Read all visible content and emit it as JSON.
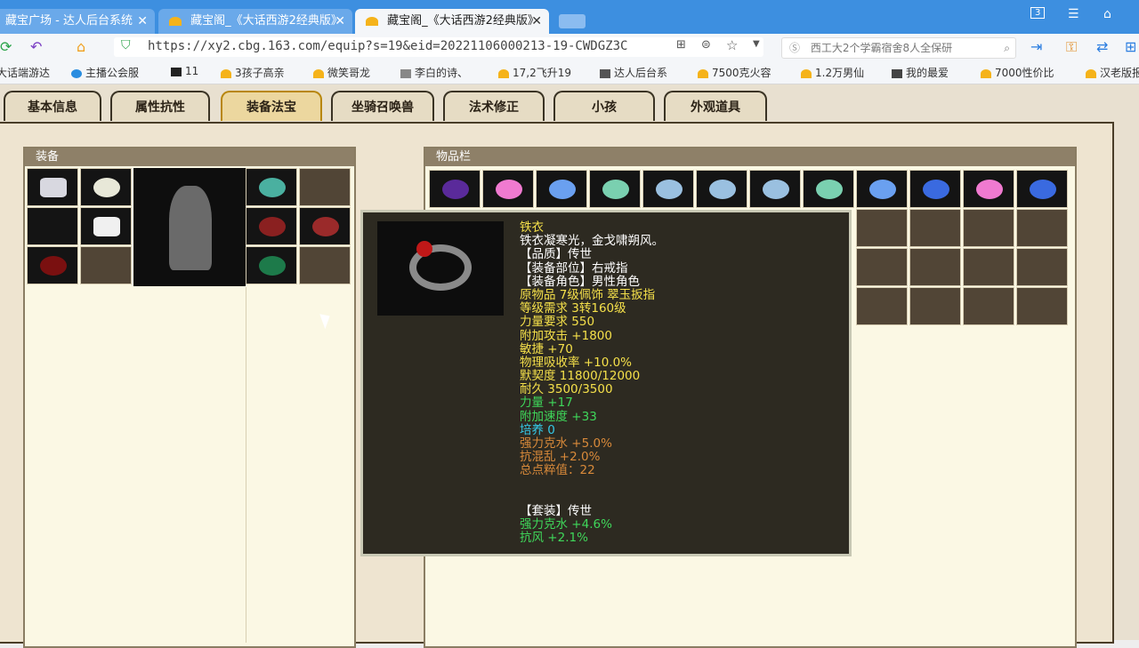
{
  "browser": {
    "tabs": [
      {
        "title": "藏宝广场 - 达人后台系统",
        "active": false
      },
      {
        "title": "藏宝阁_《大话西游2经典版》",
        "active": false
      },
      {
        "title": "藏宝阁_《大话西游2经典版》",
        "active": true
      }
    ],
    "tab_count_badge": "3",
    "url": "https://xy2.cbg.163.com/equip?s=19&eid=20221106000213-19-CWDGZ3C",
    "search_placeholder": "西工大2个学霸宿舍8人全保研",
    "bookmarks": [
      "大话端游达",
      "主播公会服",
      "11",
      "3孩子高亲",
      "微笑哥龙",
      "李白的诗、",
      "17,2飞升19",
      "达人后台系",
      "7500克火容",
      "1.2万男仙",
      "我的最爱",
      "7000性价比",
      "汉老版报"
    ]
  },
  "game": {
    "tabs": [
      "基本信息",
      "属性抗性",
      "装备法宝",
      "坐骑召唤兽",
      "法术修正",
      "小孩",
      "外观道具"
    ],
    "active_tab": "装备法宝",
    "equipment_panel_title": "装备",
    "inventory_panel_title": "物品栏",
    "tooltip": {
      "lines": [
        {
          "text": "铁衣",
          "color": "#f5e04a"
        },
        {
          "text": "铁衣凝寒光，金戈啸朔风。",
          "color": "#ffffff"
        },
        {
          "text": "【品质】传世",
          "color": "#ffffff"
        },
        {
          "text": "【装备部位】右戒指",
          "color": "#ffffff"
        },
        {
          "text": "【装备角色】男性角色",
          "color": "#ffffff"
        },
        {
          "text": "原物品 7级佩饰 翠玉扳指",
          "color": "#f5e04a"
        },
        {
          "text": "等级需求 3转160级",
          "color": "#f5e04a"
        },
        {
          "text": "力量要求 550",
          "color": "#f5e04a"
        },
        {
          "text": "附加攻击 +1800",
          "color": "#f5e04a"
        },
        {
          "text": "敏捷 +70",
          "color": "#f5e04a"
        },
        {
          "text": "物理吸收率 +10.0%",
          "color": "#f5e04a"
        },
        {
          "text": "默契度 11800/12000",
          "color": "#f5e04a"
        },
        {
          "text": "耐久 3500/3500",
          "color": "#f5e04a"
        },
        {
          "text": "力量 +17",
          "color": "#3fd75a"
        },
        {
          "text": "附加速度 +33",
          "color": "#3fd75a"
        },
        {
          "text": "培养 0",
          "color": "#35c9e8"
        },
        {
          "text": "强力克水 +5.0%",
          "color": "#d98a3a"
        },
        {
          "text": "抗混乱 +2.0%",
          "color": "#d98a3a"
        },
        {
          "text": "总点粹值：22",
          "color": "#d98a3a"
        },
        {
          "text": "",
          "color": "#ffffff"
        },
        {
          "text": "",
          "color": "#ffffff"
        },
        {
          "text": "【套装】传世",
          "color": "#ffffff"
        },
        {
          "text": "强力克水 +4.6%",
          "color": "#3fd75a"
        },
        {
          "text": "抗风 +2.1%",
          "color": "#3fd75a"
        }
      ]
    }
  }
}
